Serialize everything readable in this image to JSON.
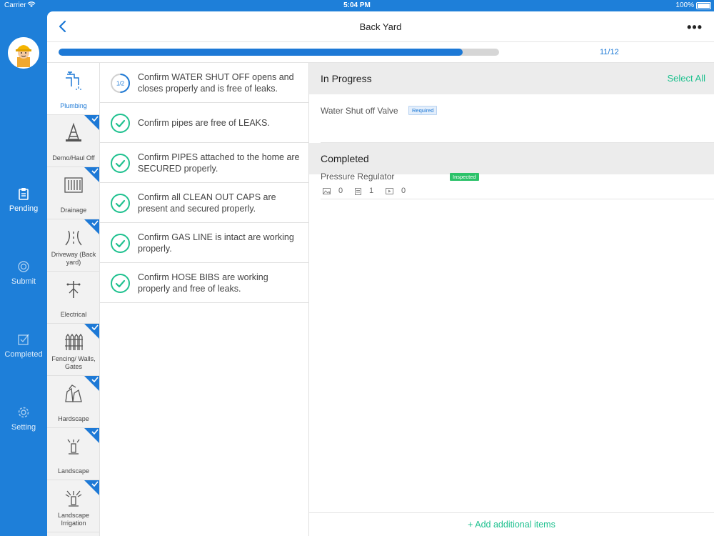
{
  "status_bar": {
    "carrier": "Carrier",
    "time": "5:04 PM",
    "battery": "100%"
  },
  "nav": {
    "items": [
      {
        "label": "Pending",
        "icon": "clipboard-icon"
      },
      {
        "label": "Submit",
        "icon": "target-icon"
      },
      {
        "label": "Completed",
        "icon": "checkbox-icon"
      },
      {
        "label": "Setting",
        "icon": "gear-icon"
      }
    ]
  },
  "header": {
    "title": "Back Yard",
    "more_label": "•••"
  },
  "progress": {
    "value": 0.917,
    "label": "11/12"
  },
  "categories": [
    {
      "label": "Plumbing",
      "icon": "faucet-icon",
      "active": true,
      "done": false
    },
    {
      "label": "Demo/Haul Off",
      "icon": "traffic-cone-icon",
      "done": true
    },
    {
      "label": "Drainage",
      "icon": "drain-grate-icon",
      "done": true
    },
    {
      "label": "Driveway (Back yard)",
      "icon": "road-icon",
      "done": true
    },
    {
      "label": "Electrical",
      "icon": "power-pole-icon",
      "done": false
    },
    {
      "label": "Fencing/ Walls, Gates",
      "icon": "fence-icon",
      "done": true
    },
    {
      "label": "Hardscape",
      "icon": "stones-icon",
      "done": true
    },
    {
      "label": "Landscape",
      "icon": "sprinkler-icon",
      "done": true
    },
    {
      "label": "Landscape Irrigation",
      "icon": "sprinkler-spray-icon",
      "done": true
    }
  ],
  "checklist": [
    {
      "text": "Confirm WATER SHUT OFF opens and closes properly and is free of leaks.",
      "state": "partial",
      "fraction": "1/2"
    },
    {
      "text": "Confirm pipes are free of LEAKS.",
      "state": "done"
    },
    {
      "text": "Confirm PIPES attached to the home are SECURED properly.",
      "state": "done"
    },
    {
      "text": "Confirm  all CLEAN OUT CAPS are present and secured properly.",
      "state": "done"
    },
    {
      "text": "Confirm GAS LINE is intact are working properly.",
      "state": "done"
    },
    {
      "text": "Confirm HOSE BIBS are working properly and free of leaks.",
      "state": "done"
    }
  ],
  "in_progress": {
    "title": "In Progress",
    "select_all": "Select All",
    "items": [
      {
        "name": "Water Shut off Valve",
        "badge": "Required"
      }
    ]
  },
  "completed": {
    "title": "Completed",
    "items": [
      {
        "name": "Pressure Regulator",
        "badge": "Inspected",
        "photos": "0",
        "notes": "1",
        "videos": "0"
      }
    ]
  },
  "add_items": "+  Add additional items",
  "colors": {
    "brand_blue": "#1d79d6",
    "rail_blue": "#1e7fd9",
    "accent_green": "#1fc18f",
    "badge_green": "#2cc26a"
  }
}
